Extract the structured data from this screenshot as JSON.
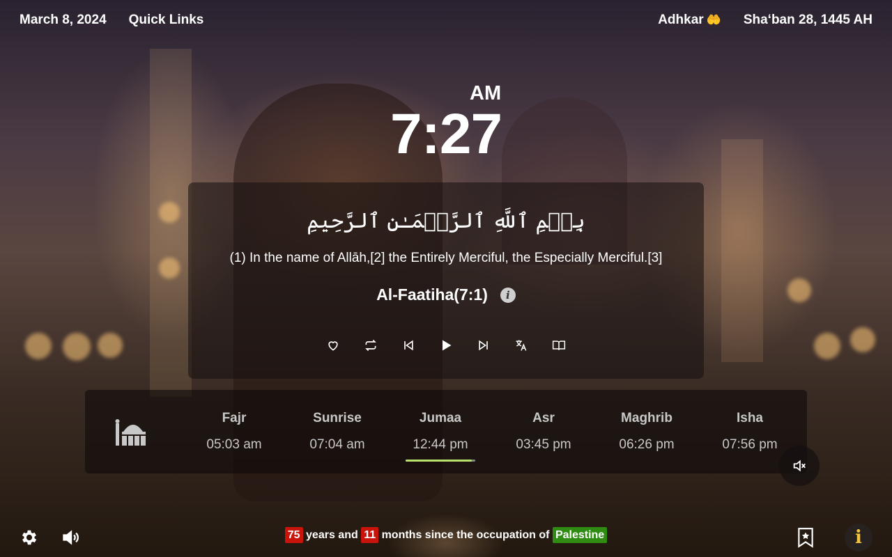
{
  "header": {
    "date": "March 8, 2024",
    "quick_links": "Quick Links",
    "adhkar": "Adhkar",
    "adhkar_icon": "🤲",
    "hijri_date": "Sha‘ban 28, 1445 AH"
  },
  "clock": {
    "ampm": "AM",
    "time": "7:27"
  },
  "verse": {
    "arabic": "بِسۡمِ ٱللَّهِ ٱلرَّحۡمَـٰنِ ٱلرَّحِيمِ",
    "translation": "(1) In the name of Allāh,[2] the Entirely Merciful, the Especially Merciful.[3]",
    "reference": "Al-Faatiha(7:1)",
    "info_glyph": "i",
    "controls": [
      "heart-icon",
      "repeat-icon",
      "previous-icon",
      "play-icon",
      "next-icon",
      "translate-icon",
      "book-icon"
    ]
  },
  "prayers": [
    {
      "name": "Fajr",
      "time": "05:03 am"
    },
    {
      "name": "Sunrise",
      "time": "07:04 am"
    },
    {
      "name": "Jumaa",
      "time": "12:44 pm"
    },
    {
      "name": "Asr",
      "time": "03:45 pm"
    },
    {
      "name": "Maghrib",
      "time": "06:26 pm"
    },
    {
      "name": "Isha",
      "time": "07:56 pm"
    }
  ],
  "next_prayer_progress": 0.95,
  "footer": {
    "years": "75",
    "years_text": "years and",
    "months": "11",
    "months_text": "months since the occupation of",
    "country": "Palestine",
    "info_glyph": "i"
  },
  "colors": {
    "accent_yellow": "#f5c542",
    "progress_green": "#b9e26a",
    "badge_red": "#c9140c",
    "badge_green": "#2f8b12"
  }
}
